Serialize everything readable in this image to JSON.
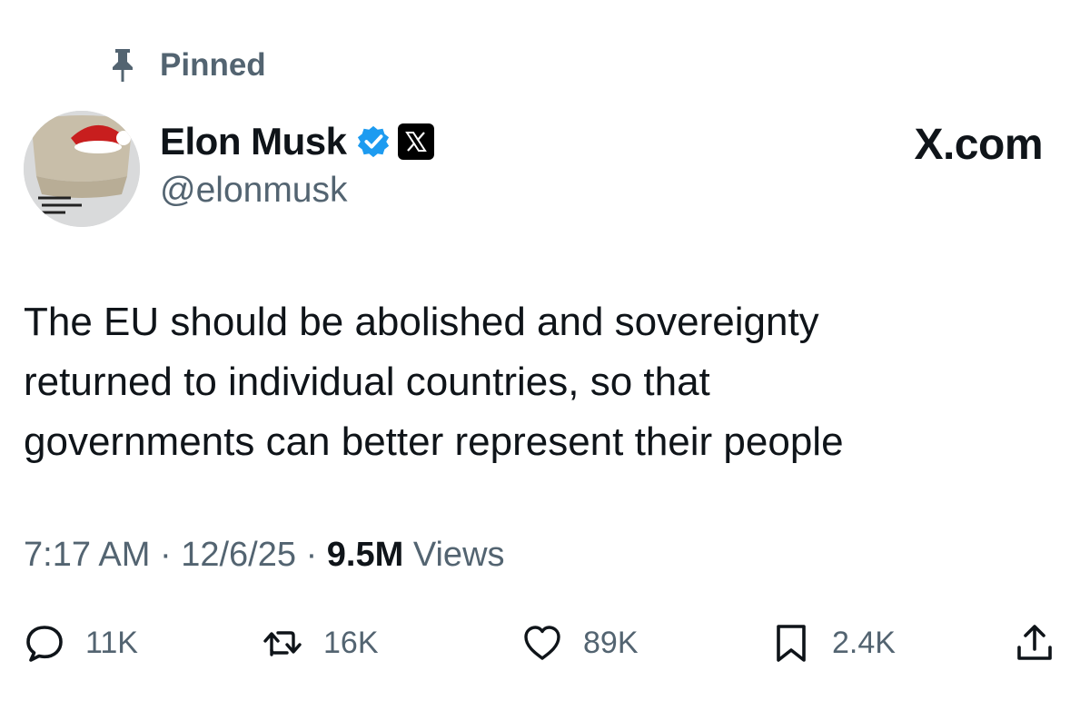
{
  "pinned": {
    "label": "Pinned"
  },
  "author": {
    "display_name": "Elon Musk",
    "handle": "@elonmusk",
    "verified": true,
    "affiliation_badge": "x-logo-icon"
  },
  "brand_link": "X.com",
  "tweet": {
    "lines": [
      "The EU should be abolished and sovereignty",
      "returned to individual countries, so that",
      "governments can better represent their people"
    ]
  },
  "meta": {
    "time": "7:17 AM",
    "separator": "·",
    "date": "12/6/25",
    "views_count": "9.5M",
    "views_label": "Views"
  },
  "actions": {
    "reply_count": "11K",
    "retweet_count": "16K",
    "like_count": "89K",
    "bookmark_count": "2.4K"
  },
  "colors": {
    "text": "#0f1419",
    "secondary": "#536471",
    "verified_blue": "#1d9bf0"
  }
}
